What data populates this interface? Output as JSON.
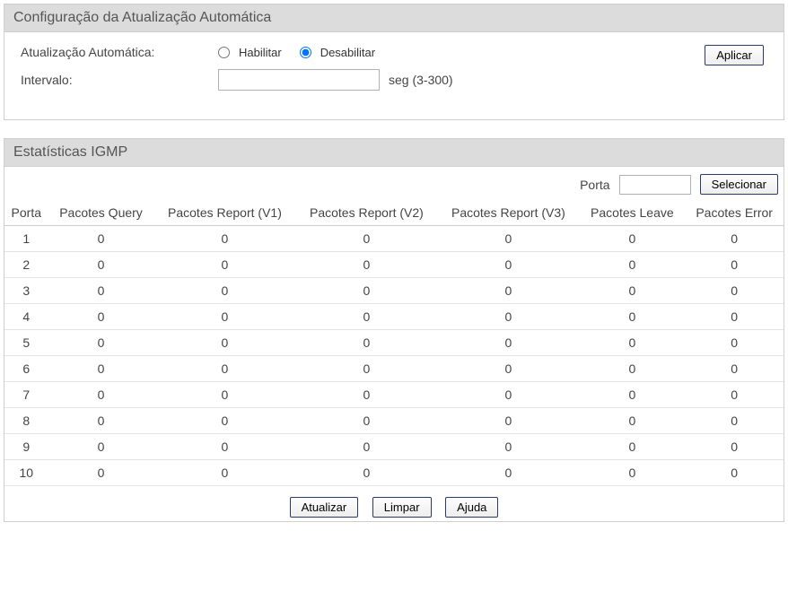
{
  "autoRefresh": {
    "header": "Configuração da Atualização Automática",
    "autoLabel": "Atualização Automática:",
    "enableLabel": "Habilitar",
    "disableLabel": "Desabilitar",
    "selected": "disable",
    "intervalLabel": "Intervalo:",
    "intervalValue": "",
    "intervalSuffix": "seg (3-300)",
    "applyLabel": "Aplicar"
  },
  "stats": {
    "header": "Estatísticas IGMP",
    "portLabel": "Porta",
    "portInput": "",
    "selectLabel": "Selecionar",
    "columns": {
      "port": "Porta",
      "query": "Pacotes Query",
      "v1": "Pacotes Report (V1)",
      "v2": "Pacotes Report (V2)",
      "v3": "Pacotes Report (V3)",
      "leave": "Pacotes Leave",
      "error": "Pacotes Error"
    },
    "rows": [
      {
        "port": "1",
        "query": "0",
        "v1": "0",
        "v2": "0",
        "v3": "0",
        "leave": "0",
        "error": "0"
      },
      {
        "port": "2",
        "query": "0",
        "v1": "0",
        "v2": "0",
        "v3": "0",
        "leave": "0",
        "error": "0"
      },
      {
        "port": "3",
        "query": "0",
        "v1": "0",
        "v2": "0",
        "v3": "0",
        "leave": "0",
        "error": "0"
      },
      {
        "port": "4",
        "query": "0",
        "v1": "0",
        "v2": "0",
        "v3": "0",
        "leave": "0",
        "error": "0"
      },
      {
        "port": "5",
        "query": "0",
        "v1": "0",
        "v2": "0",
        "v3": "0",
        "leave": "0",
        "error": "0"
      },
      {
        "port": "6",
        "query": "0",
        "v1": "0",
        "v2": "0",
        "v3": "0",
        "leave": "0",
        "error": "0"
      },
      {
        "port": "7",
        "query": "0",
        "v1": "0",
        "v2": "0",
        "v3": "0",
        "leave": "0",
        "error": "0"
      },
      {
        "port": "8",
        "query": "0",
        "v1": "0",
        "v2": "0",
        "v3": "0",
        "leave": "0",
        "error": "0"
      },
      {
        "port": "9",
        "query": "0",
        "v1": "0",
        "v2": "0",
        "v3": "0",
        "leave": "0",
        "error": "0"
      },
      {
        "port": "10",
        "query": "0",
        "v1": "0",
        "v2": "0",
        "v3": "0",
        "leave": "0",
        "error": "0"
      }
    ],
    "buttons": {
      "refresh": "Atualizar",
      "clear": "Limpar",
      "help": "Ajuda"
    }
  }
}
